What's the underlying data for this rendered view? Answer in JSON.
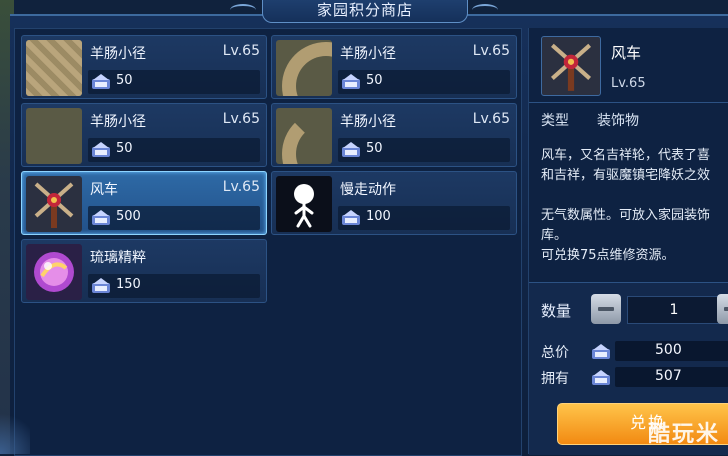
{
  "window": {
    "title": "家园积分商店"
  },
  "items": [
    {
      "name": "羊肠小径",
      "level": "Lv.65",
      "price": "50",
      "thumb": "stone-path-icon",
      "selected": false
    },
    {
      "name": "羊肠小径",
      "level": "Lv.65",
      "price": "50",
      "thumb": "curved-path-icon",
      "selected": false
    },
    {
      "name": "羊肠小径",
      "level": "Lv.65",
      "price": "50",
      "thumb": "curved-path-icon",
      "selected": false
    },
    {
      "name": "羊肠小径",
      "level": "Lv.65",
      "price": "50",
      "thumb": "curved-path-icon",
      "selected": false
    },
    {
      "name": "风车",
      "level": "Lv.65",
      "price": "500",
      "thumb": "windmill-icon",
      "selected": true
    },
    {
      "name": "慢走动作",
      "level": "",
      "price": "100",
      "thumb": "walking-figure-icon",
      "selected": false
    },
    {
      "name": "琉璃精粹",
      "level": "",
      "price": "150",
      "thumb": "crystal-orb-icon",
      "selected": false
    }
  ],
  "detail": {
    "name": "风车",
    "level": "Lv.65",
    "type_label": "类型",
    "type_value": "装饰物",
    "description": [
      "风车，又名吉祥轮，代表了喜",
      "和吉祥，有驱魔镇宅降妖之效",
      "",
      "无气数属性。可放入家园装饰",
      "库。",
      "可兑换75点维修资源。"
    ]
  },
  "purchase": {
    "quantity_label": "数量",
    "quantity": "1",
    "total_label": "总价",
    "total": "500",
    "owned_label": "拥有",
    "owned": "507",
    "buy_label": "兑换"
  },
  "watermark": "酷玩米",
  "colors": {
    "accent": "#8ed4ff",
    "button": "#f28a12",
    "panel": "#0e2242"
  }
}
